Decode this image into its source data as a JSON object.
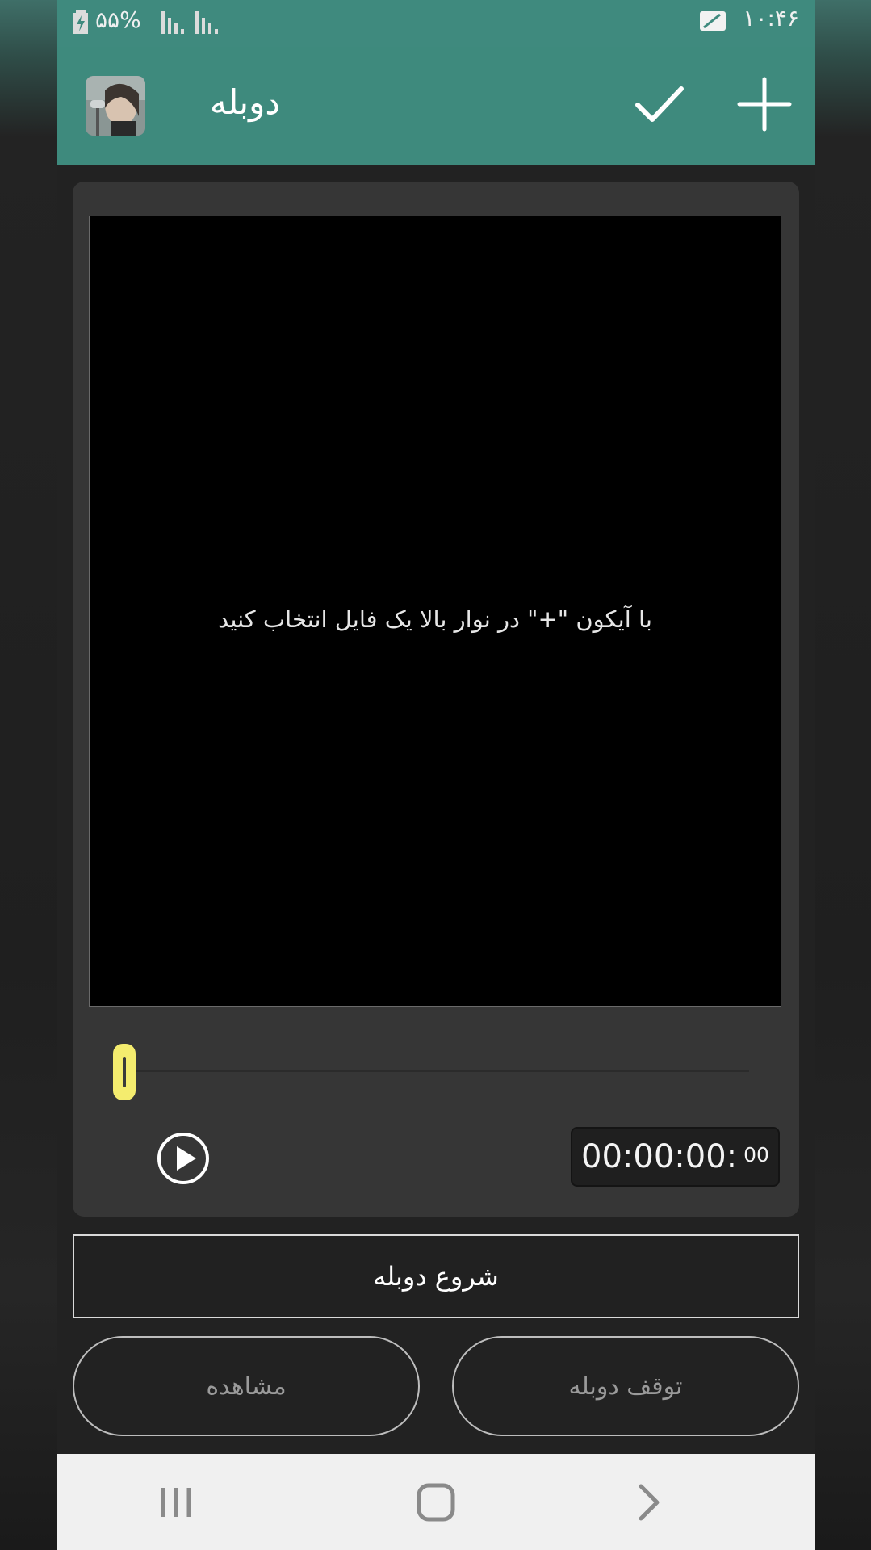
{
  "status_bar": {
    "battery_percent": "۵۵%",
    "time": "۱۰:۴۶"
  },
  "app_bar": {
    "title": "دوبله",
    "check_icon": "check-icon",
    "plus_icon": "plus-icon"
  },
  "player": {
    "hint": "با آیکون \"+\" در نوار بالا یک فایل انتخاب کنید",
    "time_main": "00:00:00:",
    "time_frac": "00",
    "seek_progress": 0.0
  },
  "actions": {
    "start_dub": "شروع دوبله",
    "view": "مشاهده",
    "stop_dub": "توقف دوبله"
  },
  "nav": {
    "recent_icon": "recent-apps-icon",
    "home_icon": "home-icon",
    "back_icon": "back-icon"
  },
  "colors": {
    "accent": "#3e8a7d",
    "thumb": "#f4ec6e"
  }
}
